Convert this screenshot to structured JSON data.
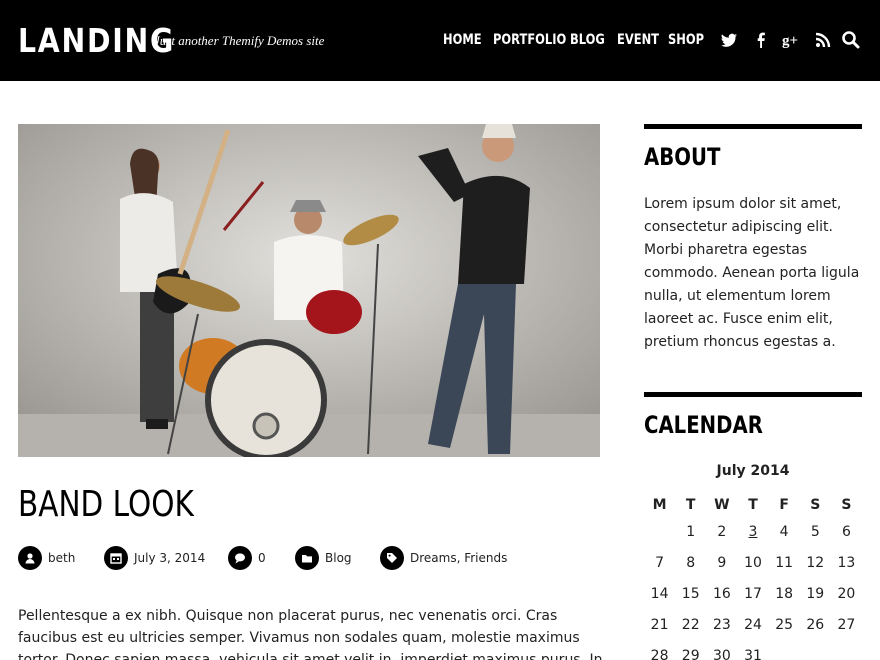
{
  "site": {
    "title": "LANDING",
    "tagline": "Just another Themify Demos site"
  },
  "nav": {
    "items": [
      "HOME",
      "PORTFOLIO",
      "BLOG",
      "EVENT",
      "SHOP"
    ],
    "social_icons": [
      "twitter-icon",
      "facebook-icon",
      "google-plus-icon",
      "rss-icon",
      "search-icon"
    ]
  },
  "post": {
    "title": "BAND LOOK",
    "author": "beth",
    "date": "July 3, 2014",
    "comments": "0",
    "category": "Blog",
    "tags": "Dreams, Friends",
    "excerpt": "Pellentesque a ex nibh. Quisque non placerat purus, nec venenatis orci. Cras faucibus est eu ultricies semper. Vivamus non sodales quam, molestie maximus tortor. Donec sapien massa, vehicula sit amet velit in, imperdiet maximus purus. In non placerat libero. Donec"
  },
  "sidebar": {
    "about": {
      "title": "ABOUT",
      "text": "Lorem ipsum dolor sit amet, consectetur adipiscing elit. Morbi pharetra egestas commodo. Aenean porta ligula nulla, ut elementum lorem laoreet ac. Fusce enim elit, pretium rhoncus egestas a."
    },
    "calendar": {
      "title": "CALENDAR",
      "caption": "July 2014",
      "weekdays": [
        "M",
        "T",
        "W",
        "T",
        "F",
        "S",
        "S"
      ],
      "weeks": [
        [
          "",
          "1",
          "2",
          "3",
          "4",
          "5",
          "6"
        ],
        [
          "7",
          "8",
          "9",
          "10",
          "11",
          "12",
          "13"
        ],
        [
          "14",
          "15",
          "16",
          "17",
          "18",
          "19",
          "20"
        ],
        [
          "21",
          "22",
          "23",
          "24",
          "25",
          "26",
          "27"
        ],
        [
          "28",
          "29",
          "30",
          "31",
          "",
          "",
          ""
        ]
      ],
      "linked_day": "3"
    }
  },
  "colors": {
    "header_bg": "#000000",
    "text": "#222222",
    "accent": "#000000"
  }
}
